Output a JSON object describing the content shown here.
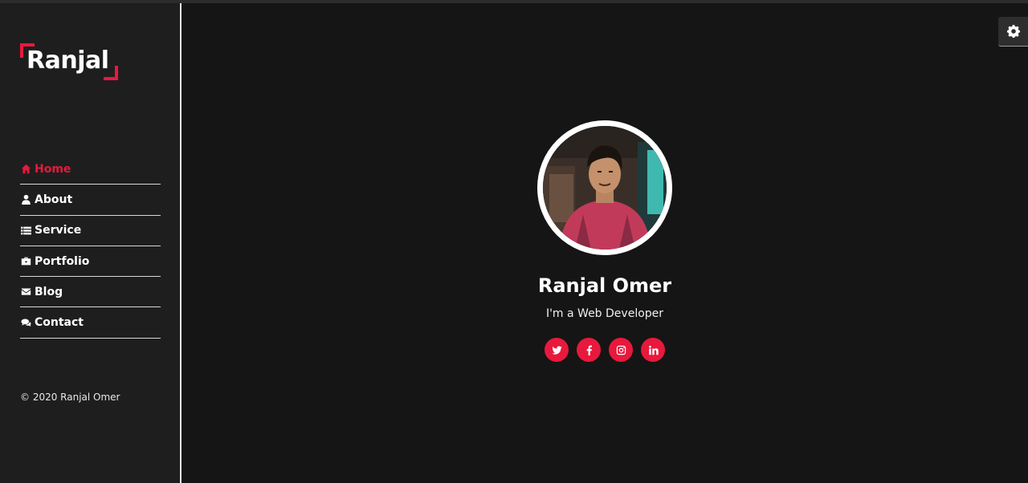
{
  "brand": {
    "logo_text": "Ranjal",
    "accent_color": "#e8193c"
  },
  "nav": {
    "items": [
      {
        "label": "Home",
        "icon": "home-icon",
        "active": true
      },
      {
        "label": "About",
        "icon": "user-icon",
        "active": false
      },
      {
        "label": "Service",
        "icon": "list-icon",
        "active": false
      },
      {
        "label": "Portfolio",
        "icon": "briefcase-icon",
        "active": false
      },
      {
        "label": "Blog",
        "icon": "envelope-icon",
        "active": false
      },
      {
        "label": "Contact",
        "icon": "comments-icon",
        "active": false
      }
    ]
  },
  "footer": {
    "copyright": "© 2020 Ranjal Omer"
  },
  "hero": {
    "name": "Ranjal Omer",
    "role": "I'm a Web Developer",
    "socials": [
      "twitter-icon",
      "facebook-icon",
      "instagram-icon",
      "linkedin-icon"
    ]
  },
  "settings": {
    "icon": "gear-icon"
  }
}
